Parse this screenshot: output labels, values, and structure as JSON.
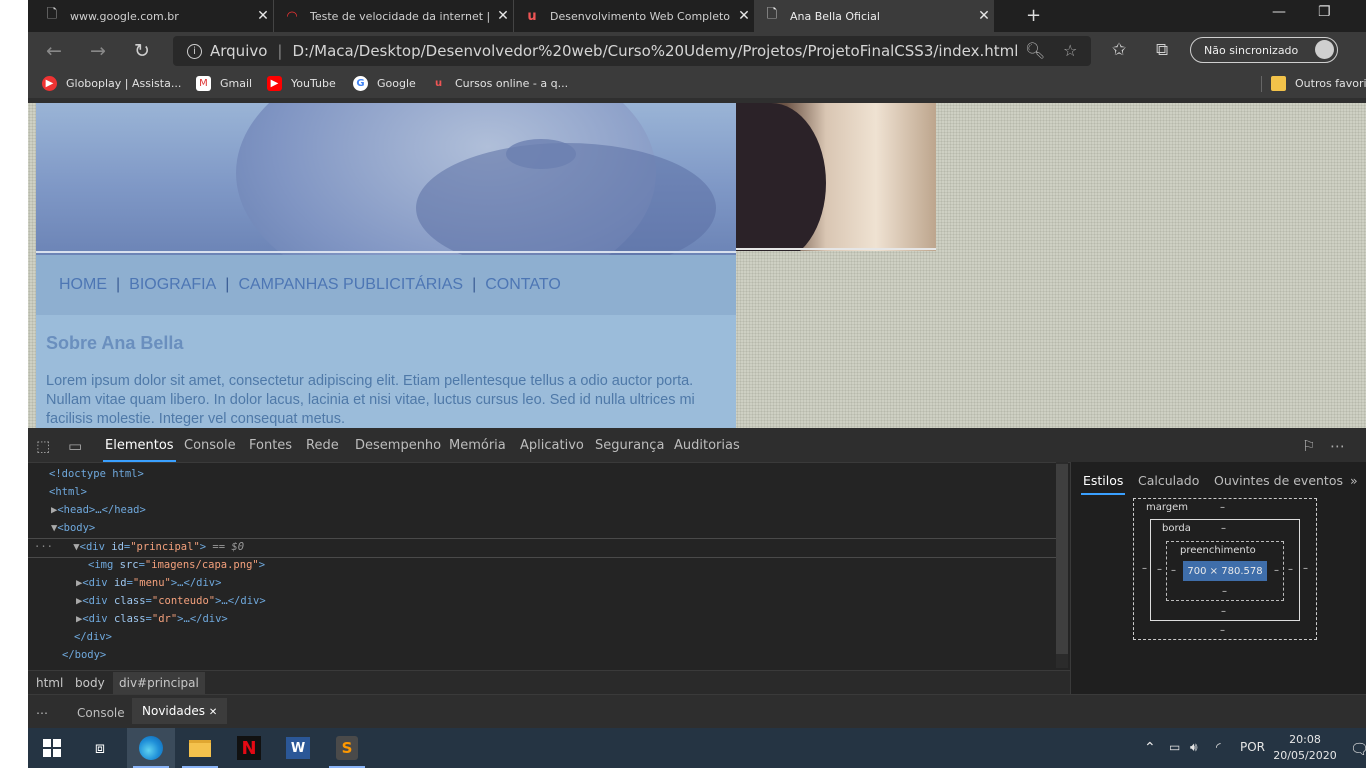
{
  "browser": {
    "tabs": [
      {
        "title": "www.google.com.br",
        "icon": "page-icon"
      },
      {
        "title": "Teste de velocidade da internet | ",
        "icon": "speedtest-icon"
      },
      {
        "title": "Desenvolvimento Web Completo",
        "icon": "udemy-icon"
      },
      {
        "title": "Ana Bella Oficial",
        "icon": "page-icon",
        "active": true
      }
    ],
    "address": {
      "label": "Arquivo",
      "url": "D:/Maca/Desktop/Desenvolvedor%20web/Curso%20Udemy/Projetos/ProjetoFinalCSS3/index.html"
    },
    "sync_label": "Não sincronizado",
    "bookmarks": [
      {
        "label": "Globoplay | Assista...",
        "icon": "globoplay-icon"
      },
      {
        "label": "Gmail",
        "icon": "gmail-icon"
      },
      {
        "label": "YouTube",
        "icon": "youtube-icon"
      },
      {
        "label": "Google",
        "icon": "google-icon"
      },
      {
        "label": "Cursos online - a q...",
        "icon": "udemy-icon"
      }
    ],
    "other_favorites": "Outros favoritos"
  },
  "page": {
    "menu": [
      "HOME",
      "BIOGRAFIA",
      "CAMPANHAS PUBLICITÁRIAS",
      "CONTATO"
    ],
    "menu_separator": "|",
    "heading": "Sobre Ana Bella",
    "paragraph": "Lorem ipsum dolor sit amet, consectetur adipiscing elit. Etiam pellentesque tellus a odio auctor porta. Nullam vitae quam libero. In dolor lacus, lacinia et nisi vitae, luctus cursus leo. Sed id nulla ultrices mi facilisis molestie. Integer vel consequat metus."
  },
  "devtools": {
    "tabs": [
      "Elementos",
      "Console",
      "Fontes",
      "Rede",
      "Desempenho",
      "Memória",
      "Aplicativo",
      "Segurança",
      "Auditorias"
    ],
    "dom": {
      "doctype": "<!doctype html>",
      "html": "<html>",
      "head": "<head>…</head>",
      "body": "<body>",
      "div_open_tag": "div",
      "div_attr": "id",
      "div_val": "\"principal\"",
      "div_suffix": " == $0",
      "img_tag": "img",
      "img_attr": "src",
      "img_val": "\"imagens/capa.png\"",
      "menu_attr": "id",
      "menu_val": "\"menu\"",
      "conteudo_attr": "class",
      "conteudo_val": "\"conteudo\"",
      "dr_attr": "class",
      "dr_val": "\"dr\"",
      "collapsed": ">…</div>",
      "div_close": "</div>",
      "body_close": "</body>"
    },
    "breadcrumbs": [
      "html",
      "body",
      "div#principal"
    ],
    "styles_tabs": [
      "Estilos",
      "Calculado",
      "Ouvintes de eventos"
    ],
    "box_model": {
      "margin_label": "margem",
      "border_label": "borda",
      "padding_label": "preenchimento",
      "content_size": "700 × 780.578",
      "dash": "–"
    },
    "drawer_tabs": [
      "Console",
      "Novidades"
    ]
  },
  "taskbar": {
    "language": "POR",
    "time": "20:08",
    "date": "20/05/2020"
  }
}
